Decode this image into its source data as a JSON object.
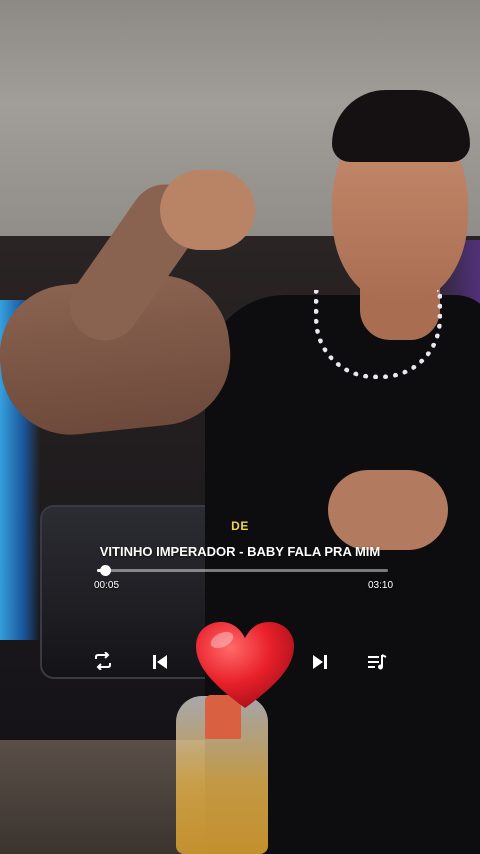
{
  "player": {
    "label": "DE",
    "title": "VITINHO IMPERADOR - BABY FALA PRA MIM",
    "elapsed": "00:05",
    "duration": "03:10",
    "progress": 0.026
  },
  "controls": {
    "repeat_icon": "repeat-icon",
    "previous_icon": "skip-previous-icon",
    "like_icon": "heart-icon",
    "next_icon": "skip-next-icon",
    "playlist_icon": "playlist-icon"
  },
  "colors": {
    "label": "#f2d24b",
    "heart": "#e8202a",
    "text": "#ffffff"
  }
}
